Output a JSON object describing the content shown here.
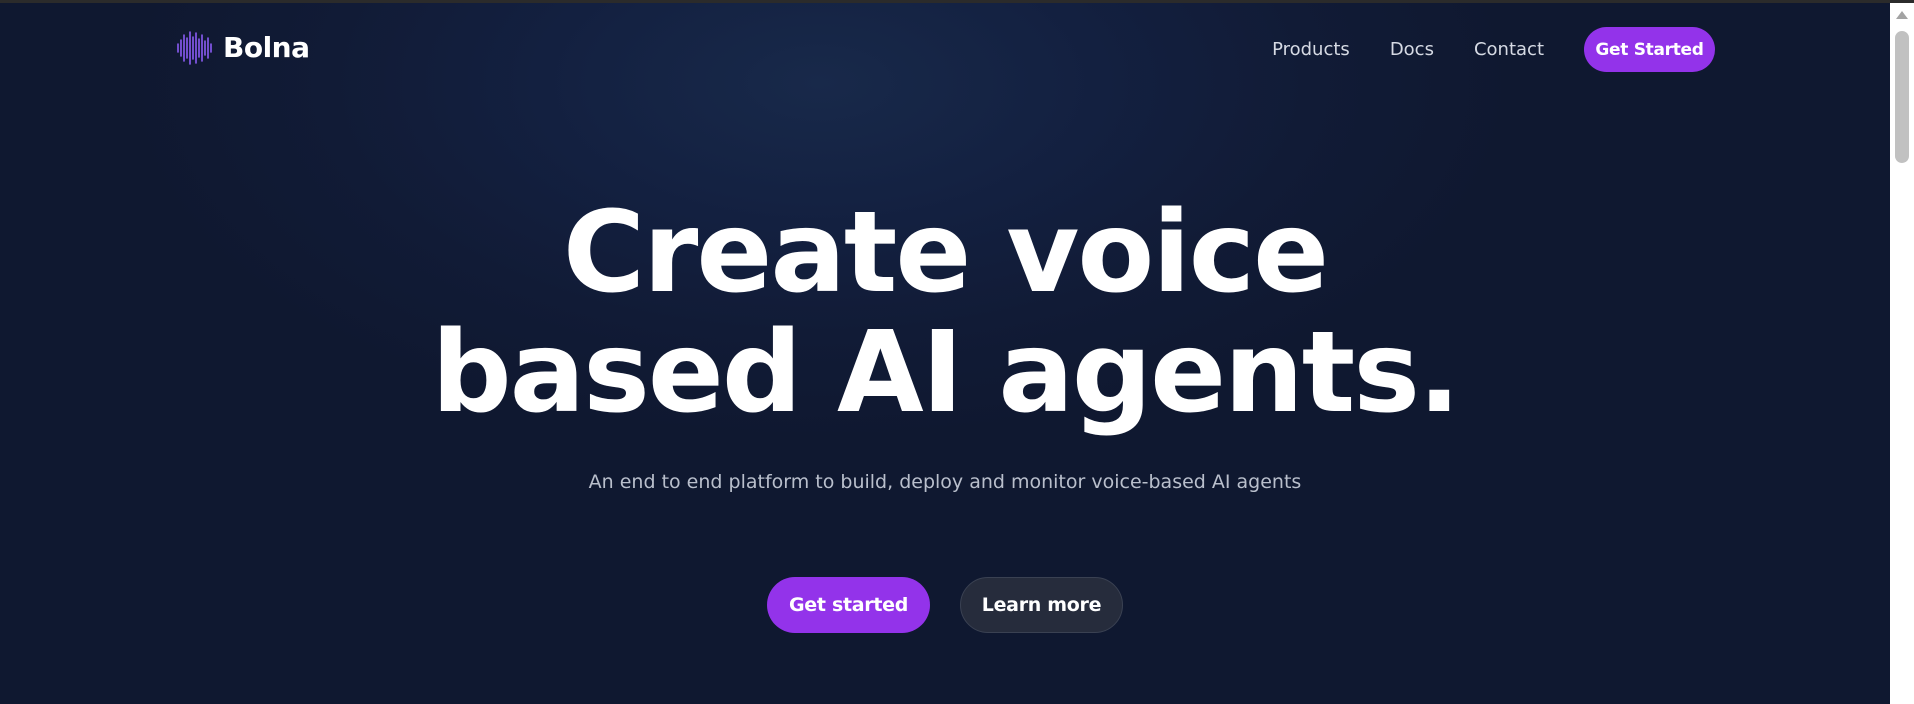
{
  "brand": {
    "name": "Bolna",
    "logo_icon": "waveform-icon",
    "logo_color": "#8b5cf6"
  },
  "nav": {
    "links": [
      "Products",
      "Docs",
      "Contact"
    ],
    "cta_label": "Get Started"
  },
  "hero": {
    "title_line1": "Create voice",
    "title_line2": "based AI agents.",
    "subtitle": "An end to end platform to build, deploy and monitor voice-based AI agents",
    "primary_label": "Get started",
    "secondary_label": "Learn more"
  },
  "colors": {
    "accent": "#9333ea",
    "background": "#111b36",
    "secondary_button": "#262c3c"
  }
}
